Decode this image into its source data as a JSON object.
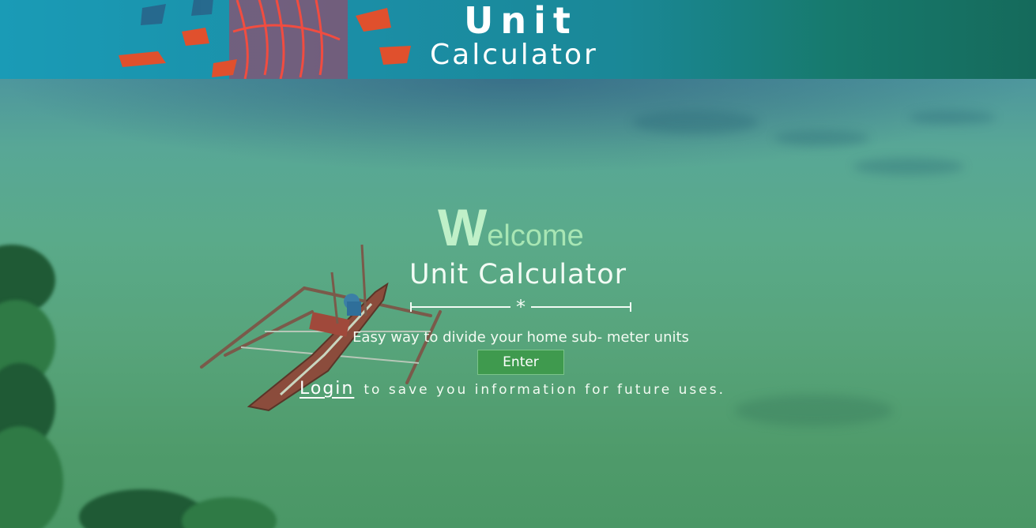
{
  "header": {
    "title_line1": "Unit",
    "title_line2": "Calculator"
  },
  "hero": {
    "welcome_initial": "W",
    "welcome_rest": "elcome",
    "subtitle": "Unit Calculator",
    "divider_symbol": "*",
    "tagline": "Easy way to divide your home sub- meter units",
    "enter_label": "Enter",
    "login_label": "Login",
    "login_suffix": "to save you information for future uses."
  },
  "colors": {
    "welcome": "#bff0c8",
    "enter_button": "#3f9a4e",
    "header_left": "#1a9bb6",
    "header_right": "#156a5b"
  }
}
